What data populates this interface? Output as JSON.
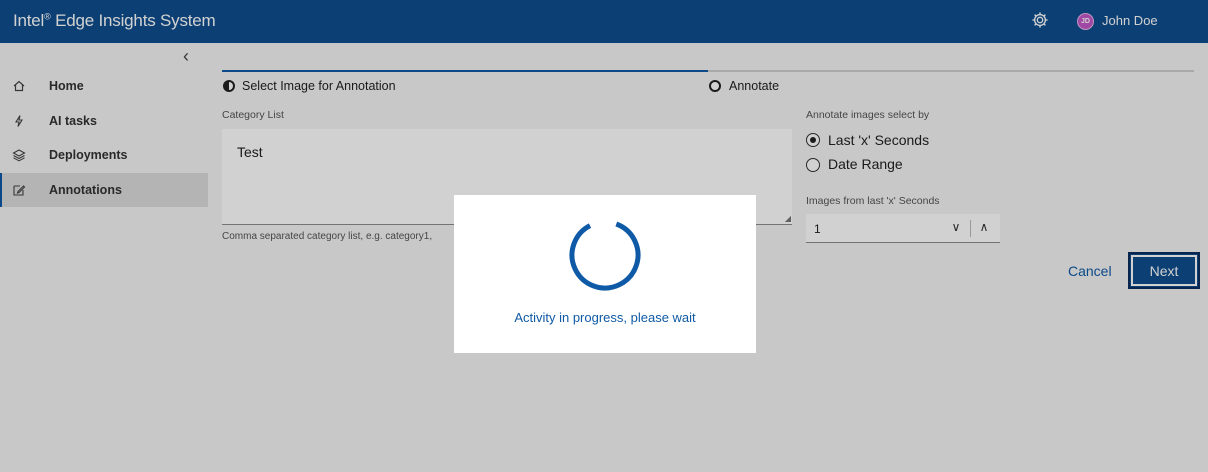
{
  "header": {
    "brand_prefix": "Intel",
    "brand_mark": "®",
    "brand_suffix": " Edge Insights System",
    "avatar_initials": "JD",
    "user_name": "John Doe"
  },
  "sidebar": {
    "items": [
      {
        "label": "Home",
        "icon": "home-icon"
      },
      {
        "label": "AI tasks",
        "icon": "bolt-icon"
      },
      {
        "label": "Deployments",
        "icon": "layers-icon"
      },
      {
        "label": "Annotations",
        "icon": "edit-icon",
        "active": true
      }
    ]
  },
  "stepper": {
    "steps": [
      {
        "label": "Select Image for Annotation",
        "state": "current"
      },
      {
        "label": "Annotate",
        "state": "pending"
      }
    ]
  },
  "form": {
    "category_label": "Category List",
    "category_value": "Test",
    "category_helper": "Comma separated category list, e.g. category1,",
    "select_by_label": "Annotate images select by",
    "options": [
      {
        "label": "Last 'x' Seconds",
        "checked": true
      },
      {
        "label": "Date Range",
        "checked": false
      }
    ],
    "seconds_label": "Images from last 'x' Seconds",
    "seconds_value": "1"
  },
  "actions": {
    "cancel_label": "Cancel",
    "next_label": "Next"
  },
  "modal": {
    "message": "Activity in progress, please wait"
  },
  "colors": {
    "header_bg": "#0f4f8f",
    "accent": "#0f5aa6",
    "avatar": "#c458c8"
  }
}
